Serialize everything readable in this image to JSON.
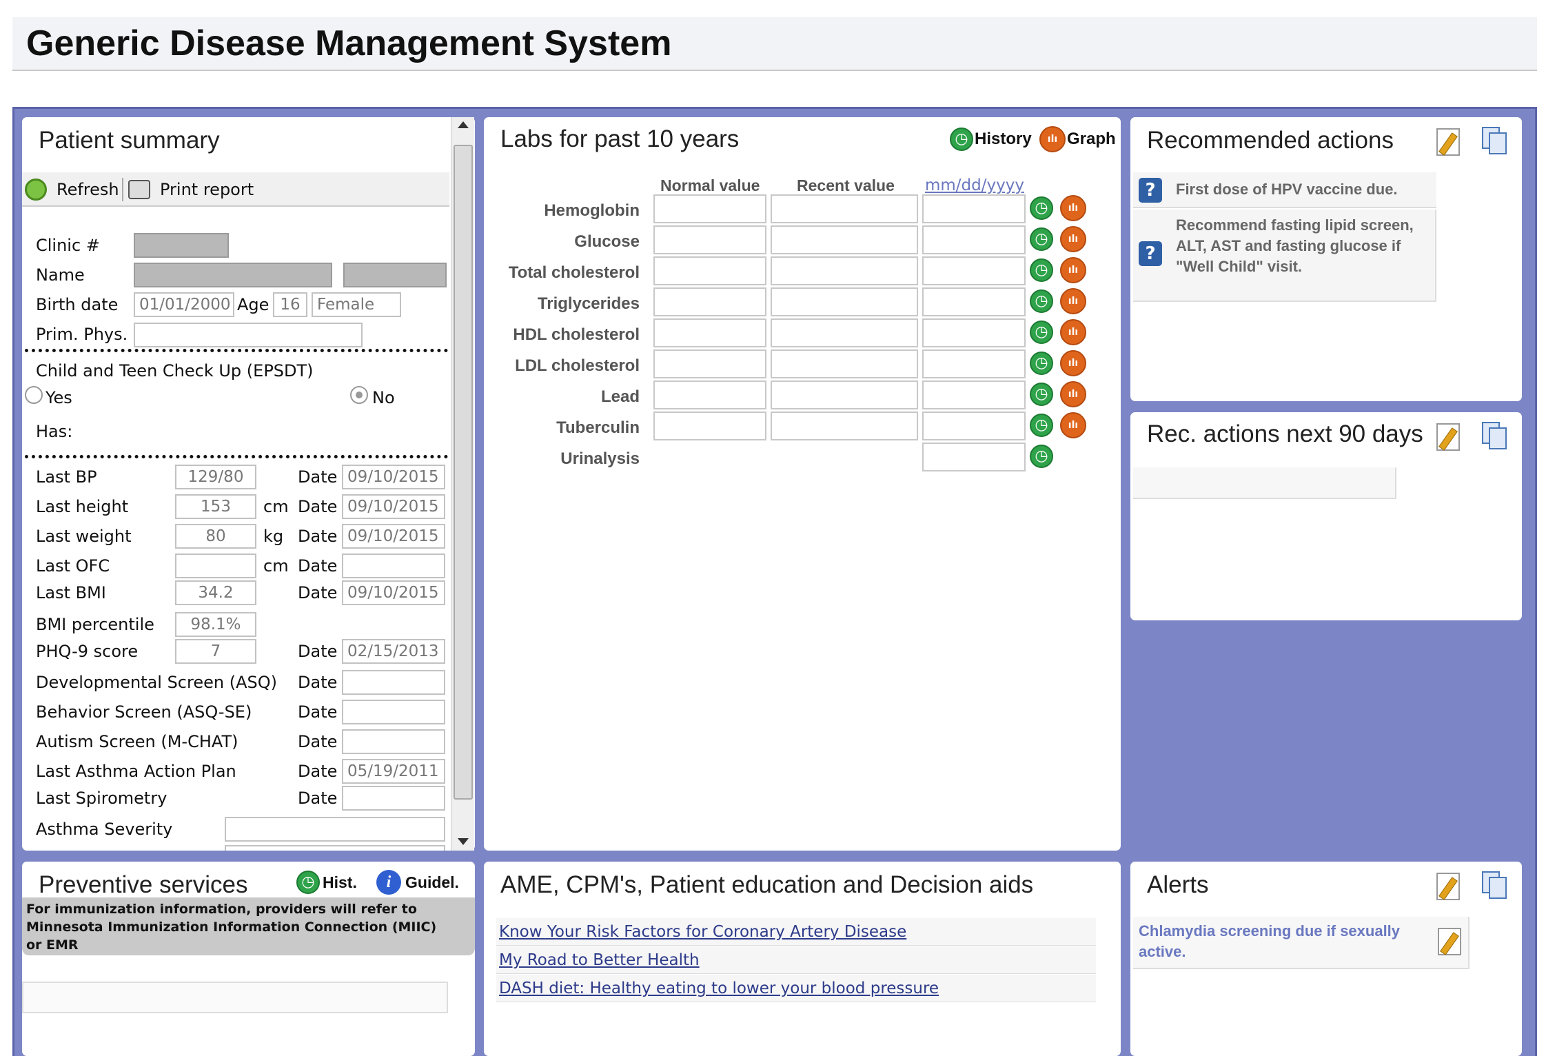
{
  "app": {
    "title": "Generic Disease Management System"
  },
  "patient_summary": {
    "title": "Patient summary",
    "toolbar": {
      "refresh_label": "Refresh",
      "print_label": "Print report"
    },
    "clinic_label": "Clinic #",
    "name_label": "Name",
    "birth_date_label": "Birth date",
    "birth_date_value": "01/01/2000",
    "age_label": "Age",
    "age_value": "16",
    "sex_value": "Female",
    "prim_phys_label": "Prim. Phys.",
    "epsdt_label": "Child and Teen Check Up (EPSDT)",
    "yes_label": "Yes",
    "no_label": "No",
    "has_label": "Has:",
    "date_label": "Date",
    "cm_unit": "cm",
    "kg_unit": "kg",
    "rows": {
      "bp": {
        "label": "Last BP",
        "value": "129/80",
        "date": "09/10/2015"
      },
      "height": {
        "label": "Last height",
        "value": "153",
        "date": "09/10/2015"
      },
      "weight": {
        "label": "Last weight",
        "value": "80",
        "date": "09/10/2015"
      },
      "ofc": {
        "label": "Last OFC",
        "value": "",
        "date": ""
      },
      "bmi": {
        "label": "Last BMI",
        "value": "34.2",
        "date": "09/10/2015"
      },
      "bmi_pct": {
        "label": "BMI percentile",
        "value": "98.1%"
      },
      "phq9": {
        "label": "PHQ-9 score",
        "value": "7",
        "date": "02/15/2013"
      },
      "asq": {
        "label": "Developmental Screen (ASQ)",
        "date": ""
      },
      "asqse": {
        "label": "Behavior Screen (ASQ-SE)",
        "date": ""
      },
      "mchat": {
        "label": "Autism Screen (M-CHAT)",
        "date": ""
      },
      "asthma_plan": {
        "label": "Last Asthma Action Plan",
        "date": "05/19/2011"
      },
      "spirometry": {
        "label": "Last Spirometry",
        "date": ""
      },
      "asthma_severity": {
        "label": "Asthma Severity"
      }
    }
  },
  "labs": {
    "title": "Labs for past 10 years",
    "history_label": "History",
    "graph_label": "Graph",
    "col_normal": "Normal value",
    "col_recent": "Recent value",
    "col_date_placeholder": "mm/dd/yyyy",
    "rows": [
      "Hemoglobin",
      "Glucose",
      "Total cholesterol",
      "Triglycerides",
      "HDL cholesterol",
      "LDL cholesterol",
      "Lead",
      "Tuberculin",
      "Urinalysis"
    ]
  },
  "recommended": {
    "title": "Recommended actions",
    "items": [
      "First dose of HPV vaccine due.",
      "Recommend fasting lipid screen, ALT, AST and fasting glucose if \"Well Child\" visit."
    ]
  },
  "rec90": {
    "title": "Rec. actions next 90 days"
  },
  "preventive": {
    "title": "Preventive services",
    "hist_label": "Hist.",
    "guidel_label": "Guidel.",
    "note": "For immunization information, providers will refer to Minnesota Immunization Information Connection (MIIC) or EMR"
  },
  "ame": {
    "title": "AME, CPM's, Patient education and Decision aids",
    "links": [
      "Know Your Risk Factors for Coronary Artery Disease",
      "My Road to Better Health",
      "DASH diet: Healthy eating to lower your blood pressure"
    ]
  },
  "alerts": {
    "title": "Alerts",
    "items": [
      "Chlamydia screening due if sexually active."
    ]
  }
}
